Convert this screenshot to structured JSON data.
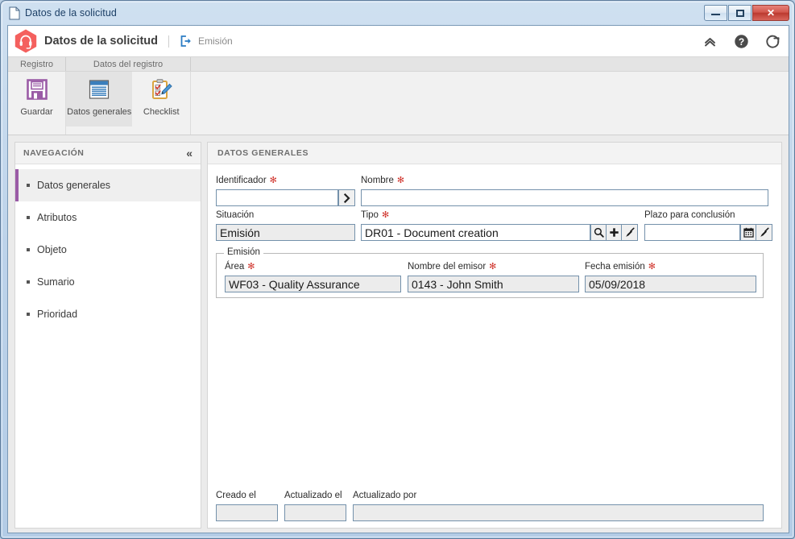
{
  "window": {
    "title": "Datos de la solicitud",
    "doc_icon": "document-icon",
    "minimize_label": "Minimizar",
    "maximize_label": "Maximizar",
    "close_label": "✕"
  },
  "app_header": {
    "logo_icon": "headset-hexagon-icon",
    "title": "Datos de la solicitud",
    "flow_icon": "export-arrow-icon",
    "flow_label": "Emisión",
    "actions": [
      {
        "name": "collapse-ribbon-icon",
        "label": "Contraer"
      },
      {
        "name": "help-icon",
        "label": "Ayuda"
      },
      {
        "name": "refresh-icon",
        "label": "Actualizar"
      }
    ]
  },
  "ribbon": {
    "tabs": [
      {
        "label": "Registro"
      },
      {
        "label": "Datos del registro"
      },
      {
        "label": ""
      }
    ],
    "buttons": [
      {
        "label": "Guardar",
        "icon": "save-floppy-icon",
        "active": false
      },
      {
        "label": "Datos generales",
        "icon": "document-lines-icon",
        "active": true
      },
      {
        "label": "Checklist",
        "icon": "clipboard-pencil-icon",
        "active": false
      }
    ]
  },
  "navigation": {
    "title": "NAVEGACIÓN",
    "collapse_icon": "chevron-double-left-icon",
    "items": [
      {
        "label": "Datos generales",
        "active": true
      },
      {
        "label": "Atributos",
        "active": false
      },
      {
        "label": "Objeto",
        "active": false
      },
      {
        "label": "Sumario",
        "active": false
      },
      {
        "label": "Prioridad",
        "active": false
      }
    ]
  },
  "form": {
    "title": "DATOS GENERALES",
    "required_marker": "✻",
    "fields": {
      "identificador": {
        "label": "Identificador",
        "required": true,
        "value": "",
        "placeholder": ""
      },
      "nombre": {
        "label": "Nombre",
        "required": true,
        "value": "",
        "placeholder": ""
      },
      "situacion": {
        "label": "Situación",
        "required": false,
        "value": "Emisión",
        "readonly": true
      },
      "tipo": {
        "label": "Tipo",
        "required": true,
        "value": "DR01 - Document creation"
      },
      "plazo": {
        "label": "Plazo para conclusión",
        "required": false,
        "value": ""
      }
    },
    "buttons": {
      "identificador_go": "chevron-right-icon",
      "tipo_search": "magnifier-icon",
      "tipo_add": "plus-icon",
      "tipo_clear": "broom-icon",
      "plazo_calendar": "calendar-icon",
      "plazo_clear": "broom-icon"
    },
    "emision_group": {
      "legend": "Emisión",
      "fields": {
        "area": {
          "label": "Área",
          "required": true,
          "value": "WF03 - Quality Assurance",
          "readonly": true
        },
        "nombre_emisor": {
          "label": "Nombre del emisor",
          "required": true,
          "value": "0143 - John Smith",
          "readonly": true
        },
        "fecha_emision": {
          "label": "Fecha emisión",
          "required": true,
          "value": "05/09/2018",
          "readonly": true
        }
      }
    },
    "footer_fields": {
      "creado_el": {
        "label": "Creado el",
        "value": "",
        "readonly": true
      },
      "actualizado_el": {
        "label": "Actualizado el",
        "value": "",
        "readonly": true
      },
      "actualizado_por": {
        "label": "Actualizado por",
        "value": "",
        "readonly": true
      }
    }
  },
  "colors": {
    "accent_purple": "#9a5ba6",
    "brand_red": "#f15f5f",
    "required_red": "#d0342c",
    "titlebar_blue": "#b6cde6",
    "close_red": "#c24339"
  }
}
